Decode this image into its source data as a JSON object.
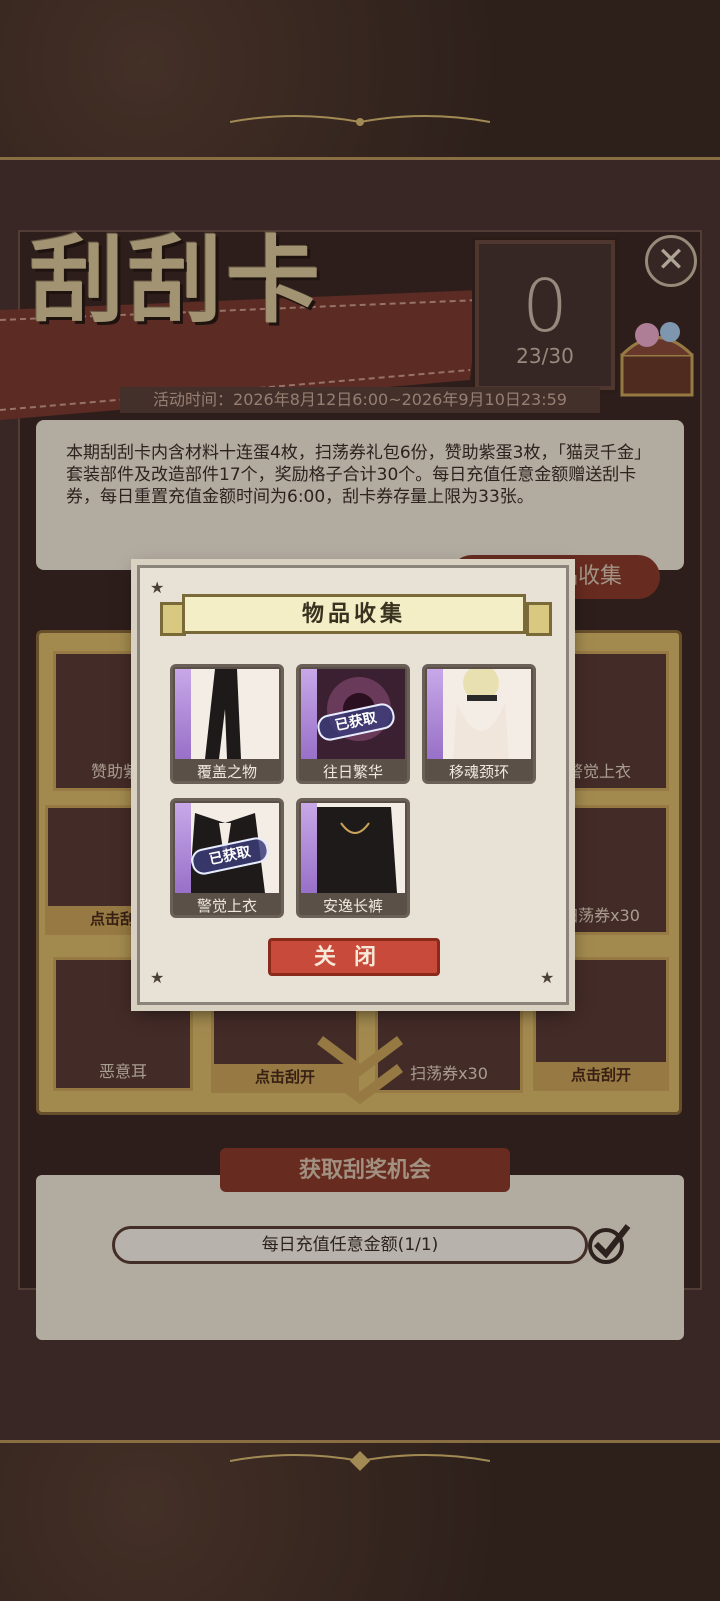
{
  "header": {
    "title": "刮刮卡",
    "scratch_count": "0",
    "scratch_ratio": "23/30",
    "close_icon": "close-icon"
  },
  "event": {
    "time": "活动时间：2026年8月12日6:00~2026年9月10日23:59",
    "description": "本期刮刮卡内含材料十连蛋4枚，扫荡券礼包6份，赞助紫蛋3枚，「猫灵千金」套装部件及改造部件17个，奖励格子合计30个。每日充值任意金额赠送刮卡券，每日重置充值金额时间为6:00，刮卡券存量上限为33张。",
    "collection_button": "物品收集"
  },
  "grid": {
    "cards": [
      {
        "label": "赞助紫蛋"
      },
      {
        "label": "警觉上衣"
      },
      {
        "label": "点击刮开"
      },
      {
        "label": "扫荡券x30"
      },
      {
        "label": "恶意耳"
      },
      {
        "label": "点击刮开"
      },
      {
        "label": "扫荡券x30"
      },
      {
        "label": "点击刮开"
      }
    ]
  },
  "chance": {
    "title": "获取刮奖机会",
    "task_label": "每日充值任意金额(1/1)"
  },
  "modal": {
    "title": "物品收集",
    "items": [
      {
        "name": "覆盖之物",
        "owned": ""
      },
      {
        "name": "往日繁华",
        "owned": "已获取"
      },
      {
        "name": "移魂颈环",
        "owned": ""
      },
      {
        "name": "警觉上衣",
        "owned": "已获取"
      },
      {
        "name": "安逸长裤",
        "owned": ""
      }
    ],
    "close_button": "关闭"
  },
  "colors": {
    "background": "#3a2a23",
    "accent_red": "#c84a3a",
    "gold": "#c9a25a",
    "parchment": "#ede4d6"
  }
}
